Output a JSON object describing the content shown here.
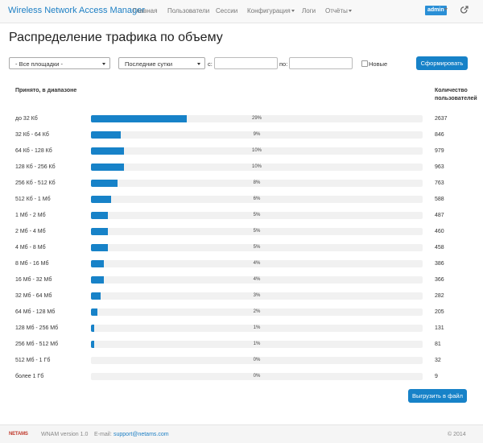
{
  "nav": {
    "brand": "Wireless Network Access Manager",
    "items": [
      {
        "label": "Главная",
        "dropdown": false
      },
      {
        "label": "Пользователи",
        "dropdown": false
      },
      {
        "label": "Сессии",
        "dropdown": false
      },
      {
        "label": "Конфигурация",
        "dropdown": true
      },
      {
        "label": "Логи",
        "dropdown": false
      },
      {
        "label": "Отчёты",
        "dropdown": true
      }
    ],
    "user": "admin",
    "logout_icon": "logout-icon"
  },
  "page": {
    "title": "Распределение трафика по объему"
  },
  "filters": {
    "site_select": "- Все площадки -",
    "period_select": "Последние сутки",
    "from_label": "с:",
    "from_value": "",
    "to_label": "по:",
    "to_value": "",
    "new_label": "Новые",
    "new_checked": false,
    "submit_label": "Сформировать"
  },
  "table": {
    "col_range": "Принято, в диапазоне",
    "col_count_line1": "Количество",
    "col_count_line2": "пользователей",
    "rows": [
      {
        "range": "до 32 Кб",
        "percent": 29,
        "percent_label": "29%",
        "count": "2637"
      },
      {
        "range": "32 Кб - 64 Кб",
        "percent": 9,
        "percent_label": "9%",
        "count": "846"
      },
      {
        "range": "64 Кб - 128 Кб",
        "percent": 10,
        "percent_label": "10%",
        "count": "979"
      },
      {
        "range": "128 Кб - 256 Кб",
        "percent": 10,
        "percent_label": "10%",
        "count": "963"
      },
      {
        "range": "256 Кб - 512 Кб",
        "percent": 8,
        "percent_label": "8%",
        "count": "763"
      },
      {
        "range": "512 Кб - 1 Мб",
        "percent": 6,
        "percent_label": "6%",
        "count": "588"
      },
      {
        "range": "1 Мб - 2 Мб",
        "percent": 5,
        "percent_label": "5%",
        "count": "487"
      },
      {
        "range": "2 Мб - 4 Мб",
        "percent": 5,
        "percent_label": "5%",
        "count": "460"
      },
      {
        "range": "4 Мб - 8 Мб",
        "percent": 5,
        "percent_label": "5%",
        "count": "458"
      },
      {
        "range": "8 Мб - 16 Мб",
        "percent": 4,
        "percent_label": "4%",
        "count": "386"
      },
      {
        "range": "16 Мб - 32 Мб",
        "percent": 4,
        "percent_label": "4%",
        "count": "366"
      },
      {
        "range": "32 Мб - 64 Мб",
        "percent": 3,
        "percent_label": "3%",
        "count": "282"
      },
      {
        "range": "64 Мб - 128 Мб",
        "percent": 2,
        "percent_label": "2%",
        "count": "205"
      },
      {
        "range": "128 Мб - 256 Мб",
        "percent": 1,
        "percent_label": "1%",
        "count": "131"
      },
      {
        "range": "256 Мб - 512 Мб",
        "percent": 1,
        "percent_label": "1%",
        "count": "81"
      },
      {
        "range": "512 Мб - 1 Гб",
        "percent": 0,
        "percent_label": "0%",
        "count": "32"
      },
      {
        "range": "более 1 Гб",
        "percent": 0,
        "percent_label": "0%",
        "count": "9"
      }
    ]
  },
  "export_label": "Выгрузить в файл",
  "footer": {
    "logo": "NETAMS",
    "version": "WNAM version 1.0",
    "email_label": "E-mail:",
    "email": "support@netams.com",
    "copyright": "© 2014"
  },
  "colors": {
    "accent": "#1782c8",
    "brand": "#1d7fc4",
    "track": "#f1f1f1"
  }
}
